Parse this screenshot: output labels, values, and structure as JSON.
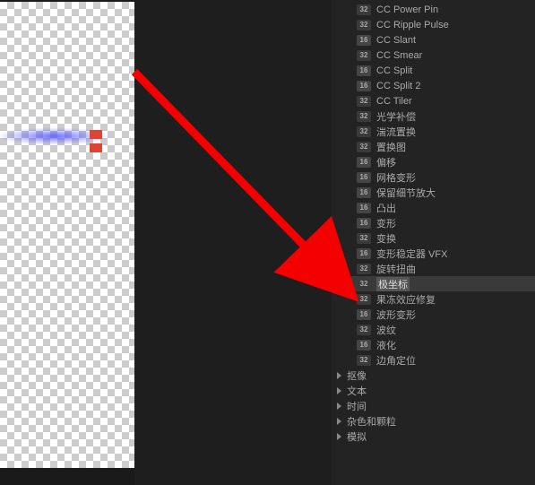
{
  "effects": [
    {
      "badge": "32",
      "label": "CC Power Pin"
    },
    {
      "badge": "32",
      "label": "CC Ripple Pulse"
    },
    {
      "badge": "16",
      "label": "CC Slant"
    },
    {
      "badge": "32",
      "label": "CC Smear"
    },
    {
      "badge": "16",
      "label": "CC Split"
    },
    {
      "badge": "16",
      "label": "CC Split 2"
    },
    {
      "badge": "32",
      "label": "CC Tiler"
    },
    {
      "badge": "32",
      "label": "光学补偿"
    },
    {
      "badge": "32",
      "label": "湍流置换"
    },
    {
      "badge": "32",
      "label": "置换图"
    },
    {
      "badge": "16",
      "label": "偏移"
    },
    {
      "badge": "16",
      "label": "网格变形"
    },
    {
      "badge": "16",
      "label": "保留细节放大"
    },
    {
      "badge": "16",
      "label": "凸出"
    },
    {
      "badge": "16",
      "label": "变形"
    },
    {
      "badge": "32",
      "label": "变换"
    },
    {
      "badge": "16",
      "label": "变形稳定器 VFX"
    },
    {
      "badge": "32",
      "label": "旋转扭曲"
    },
    {
      "badge": "32",
      "label": "极坐标",
      "highlighted": true
    },
    {
      "badge": "32",
      "label": "果冻效应修复"
    },
    {
      "badge": "16",
      "label": "波形变形"
    },
    {
      "badge": "32",
      "label": "波纹"
    },
    {
      "badge": "16",
      "label": "液化"
    },
    {
      "badge": "32",
      "label": "边角定位"
    }
  ],
  "categories": [
    {
      "label": "抠像"
    },
    {
      "label": "文本"
    },
    {
      "label": "时间"
    },
    {
      "label": "杂色和颗粒"
    },
    {
      "label": "模拟"
    }
  ],
  "badges": {
    "b32": "32",
    "b16": "16"
  }
}
